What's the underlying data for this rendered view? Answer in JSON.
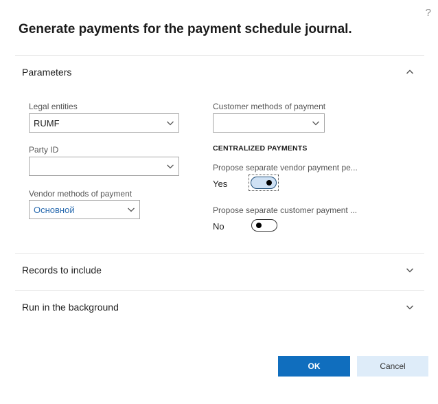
{
  "dialog": {
    "help_glyph": "?",
    "title": "Generate payments for the payment schedule journal."
  },
  "sections": {
    "parameters": "Parameters",
    "records": "Records to include",
    "background": "Run in the background"
  },
  "fields": {
    "legal_entities": {
      "label": "Legal entities",
      "value": "RUMF"
    },
    "party_id": {
      "label": "Party ID",
      "value": ""
    },
    "vendor_methods": {
      "label": "Vendor methods of payment",
      "value": "Основной"
    },
    "customer_methods": {
      "label": "Customer methods of payment",
      "value": ""
    }
  },
  "centralized": {
    "heading": "CENTRALIZED PAYMENTS",
    "vendor": {
      "label": "Propose separate vendor payment pe...",
      "state": "Yes"
    },
    "customer": {
      "label": "Propose separate customer payment ...",
      "state": "No"
    }
  },
  "buttons": {
    "ok": "OK",
    "cancel": "Cancel"
  },
  "icons": {
    "help": "help-icon",
    "chevron_up": "chevron-up-icon",
    "chevron_down": "chevron-down-icon"
  },
  "colors": {
    "primary": "#106ebe",
    "secondary": "#deecf9",
    "link": "#2b6cb0",
    "toggle_on": "#cfe1f4"
  }
}
